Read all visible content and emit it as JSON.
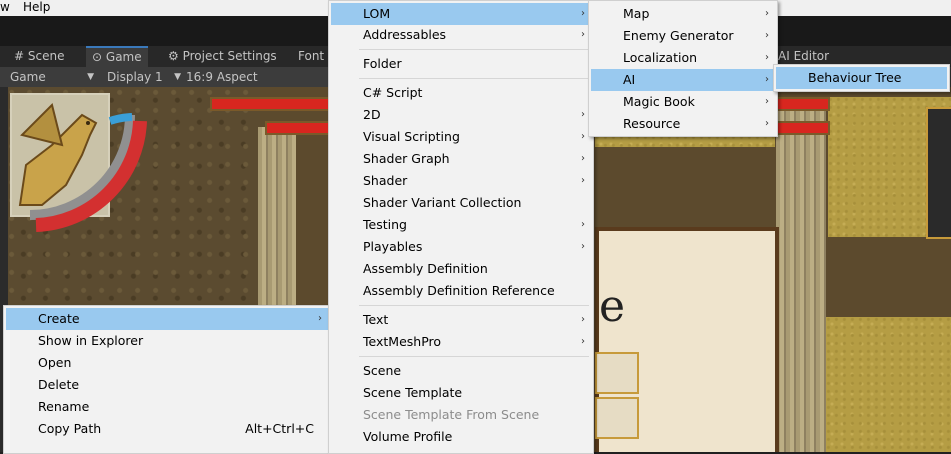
{
  "menubar": {
    "items": [
      "w",
      "Help"
    ]
  },
  "tabs": [
    {
      "label": "Scene",
      "icon": "hash-icon"
    },
    {
      "label": "Game",
      "icon": "gamepad-icon"
    },
    {
      "label": "Project Settings",
      "icon": "gear-icon"
    },
    {
      "label": "Font"
    },
    {
      "label": "AI Editor"
    }
  ],
  "toolbar": {
    "game_dropdown": "Game",
    "display_dropdown": "Display 1",
    "aspect_dropdown": "16:9 Aspect"
  },
  "context_menu": {
    "items": [
      {
        "label": "Create",
        "submenu": true,
        "highlighted": true
      },
      {
        "label": "Show in Explorer"
      },
      {
        "label": "Open"
      },
      {
        "label": "Delete"
      },
      {
        "label": "Rename"
      },
      {
        "label": "Copy Path",
        "shortcut": "Alt+Ctrl+C"
      }
    ]
  },
  "create_menu": {
    "items": [
      {
        "label": "LOM",
        "submenu": true,
        "highlighted": true
      },
      {
        "label": "Addressables",
        "submenu": true
      },
      {
        "label": "Folder"
      },
      {
        "label": "C# Script"
      },
      {
        "label": "2D",
        "submenu": true
      },
      {
        "label": "Visual Scripting",
        "submenu": true
      },
      {
        "label": "Shader Graph",
        "submenu": true
      },
      {
        "label": "Shader",
        "submenu": true
      },
      {
        "label": "Shader Variant Collection"
      },
      {
        "label": "Testing",
        "submenu": true
      },
      {
        "label": "Playables",
        "submenu": true
      },
      {
        "label": "Assembly Definition"
      },
      {
        "label": "Assembly Definition Reference"
      },
      {
        "label": "Text",
        "submenu": true
      },
      {
        "label": "TextMeshPro",
        "submenu": true
      },
      {
        "label": "Scene"
      },
      {
        "label": "Scene Template"
      },
      {
        "label": "Scene Template From Scene",
        "disabled": true
      },
      {
        "label": "Volume Profile"
      }
    ]
  },
  "lom_menu": {
    "items": [
      {
        "label": "Map",
        "submenu": true
      },
      {
        "label": "Enemy Generator",
        "submenu": true
      },
      {
        "label": "Localization",
        "submenu": true
      },
      {
        "label": "AI",
        "submenu": true,
        "highlighted": true
      },
      {
        "label": "Magic Book",
        "submenu": true
      },
      {
        "label": "Resource",
        "submenu": true
      }
    ]
  },
  "ai_menu": {
    "items": [
      {
        "label": "Behaviour Tree",
        "highlighted": true
      }
    ]
  },
  "game_view": {
    "partial_text": "e"
  },
  "colors": {
    "highlight": "#99c9ef",
    "menu_bg": "#f2f2f2",
    "unity_dark": "#282828",
    "hp_red": "#d8261f"
  }
}
